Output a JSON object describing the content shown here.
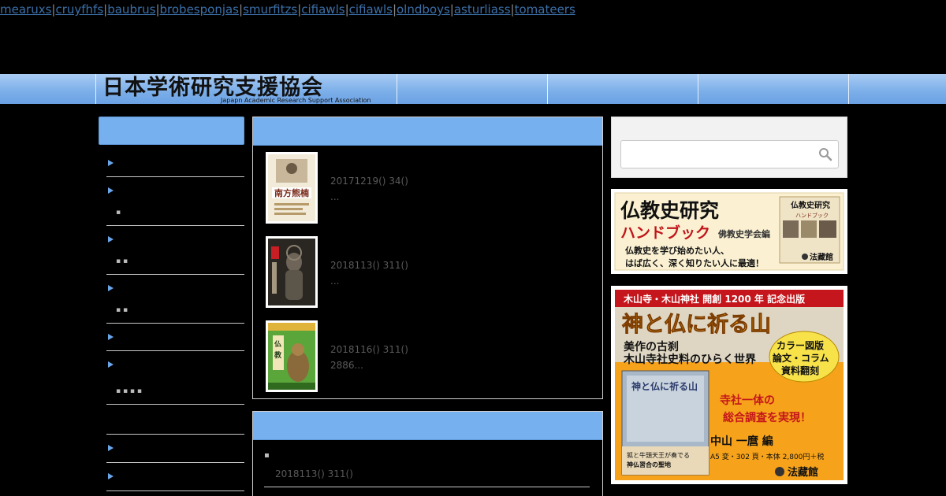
{
  "top_links": [
    "mearuxs",
    "cruyfhfs",
    "baubrus",
    "brobesponjas",
    "smurfitzs",
    "cifiawls",
    "cifiawls",
    "olndboys",
    "asturliass",
    "tomateers"
  ],
  "link_separator": "|",
  "logo": {
    "text": "日本学術研究支援協会",
    "subtitle": "Japapn Academic Research Support Association"
  },
  "sidebar": {
    "items": [
      {
        "dots": ""
      },
      {
        "dots": "▪"
      },
      {
        "dots": "▪   ▪"
      },
      {
        "dots": "▪   ▪"
      },
      {
        "dots": ""
      },
      {
        "dots": "▪   ▪    ▪     ▪"
      },
      {
        "dots": ""
      },
      {
        "dots": ""
      },
      {
        "dots": ""
      }
    ]
  },
  "posts": [
    {
      "meta": "20171219()  34()",
      "excerpt": "..."
    },
    {
      "meta": "2018113()  311()",
      "excerpt": "..."
    },
    {
      "meta": "2018116()  311()",
      "excerpt": " 2886..."
    }
  ],
  "panel2": {
    "bullet": "▪",
    "meta": "2018113()  311()"
  },
  "search": {
    "value": "",
    "placeholder": ""
  },
  "banner1": {
    "title": "仏教史研究",
    "subtitle": "ハンドブック",
    "society": "佛教史学会編",
    "line1": "仏教史を学び始めたい人、",
    "line2": "はば広く、深く知りたい人に最適！",
    "publisher": "法藏館",
    "book_title": "仏教史研究ハンドブック"
  },
  "banner2": {
    "header": "木山寺・木山神社 開創 1200 年 記念出版",
    "title": "神と仏に祈る山",
    "sub1": "美作の古刹",
    "sub2": "木山寺社史料のひらく世界",
    "badge1": "カラー図版",
    "badge2": "論文・コラム",
    "badge3": "資料翻刻",
    "slogan1": "寺社一体の",
    "slogan2": "総合調査を実現！",
    "author": "中山 一麿 編",
    "spec": "A5 変・302 頁・本体 2,800円＋税",
    "publisher": "法藏館",
    "book_title": "神と仏に祈る山",
    "book_caption1": "狐と牛頭天王が奏でる",
    "book_caption2": "神仏習合の聖地"
  },
  "colors": {
    "accent": "#77b0ef",
    "nav": "#7eb0ea",
    "link": "#3b6fa8",
    "banner2_orange": "#f6a21a",
    "banner2_red": "#c4161c"
  }
}
